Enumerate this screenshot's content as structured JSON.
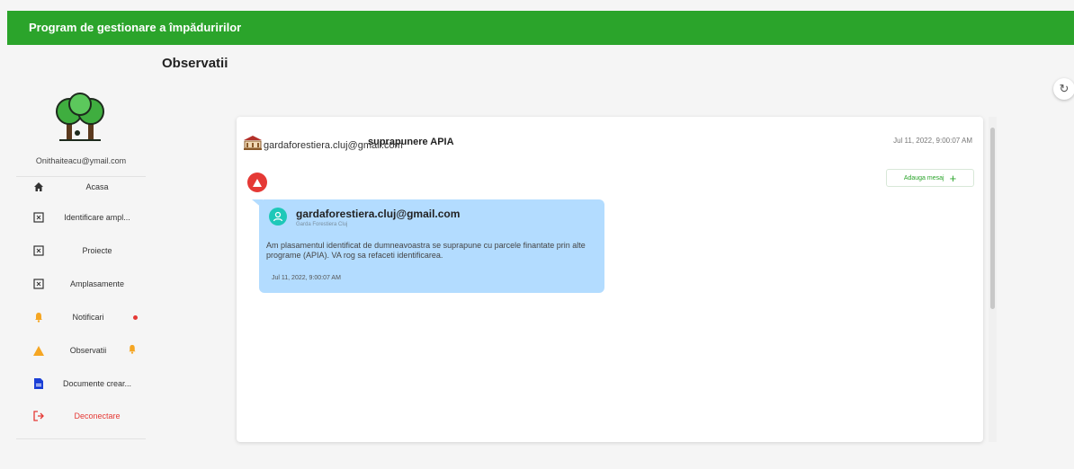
{
  "app": {
    "title": "Program de gestionare a împăduririlor"
  },
  "page": {
    "title": "Observatii"
  },
  "user": {
    "email": "Onithaiteacu@ymail.com"
  },
  "sidebar": {
    "items": [
      {
        "label": "Acasa",
        "icon": "home-icon"
      },
      {
        "label": "Identificare ampl...",
        "icon": "map-marker-icon"
      },
      {
        "label": "Proiecte",
        "icon": "map-marker-icon"
      },
      {
        "label": "Amplasamente",
        "icon": "map-marker-icon"
      },
      {
        "label": "Notificari",
        "icon": "bell-icon",
        "badge": "red-dot"
      },
      {
        "label": "Observatii",
        "icon": "warning-icon",
        "badge": "warning"
      },
      {
        "label": "Documente crear...",
        "icon": "document-icon"
      },
      {
        "label": "Deconectare",
        "icon": "logout-icon"
      }
    ]
  },
  "observation": {
    "subject": "suprapunere APIA",
    "date": "Jul 11, 2022, 9:00:07 AM",
    "sender_email": "gardaforestiera.cluj@gmail.com",
    "add_message_label": "Adauga mesaj",
    "message": {
      "author_email": "gardaforestiera.cluj@gmail.com",
      "author_org": "Garda Forestiera Cluj",
      "text": "Am plasamentul identificat de dumneavoastra se suprapune cu parcele finantate prin alte programe (APIA). VA rog sa refaceti identificarea.",
      "date": "Jul 11, 2022, 9:00:07 AM"
    }
  },
  "colors": {
    "primary": "#2ba42b",
    "danger": "#e53935",
    "warning": "#f5a623",
    "bubble": "#b3dcff",
    "avatar": "#1ec8b8"
  }
}
